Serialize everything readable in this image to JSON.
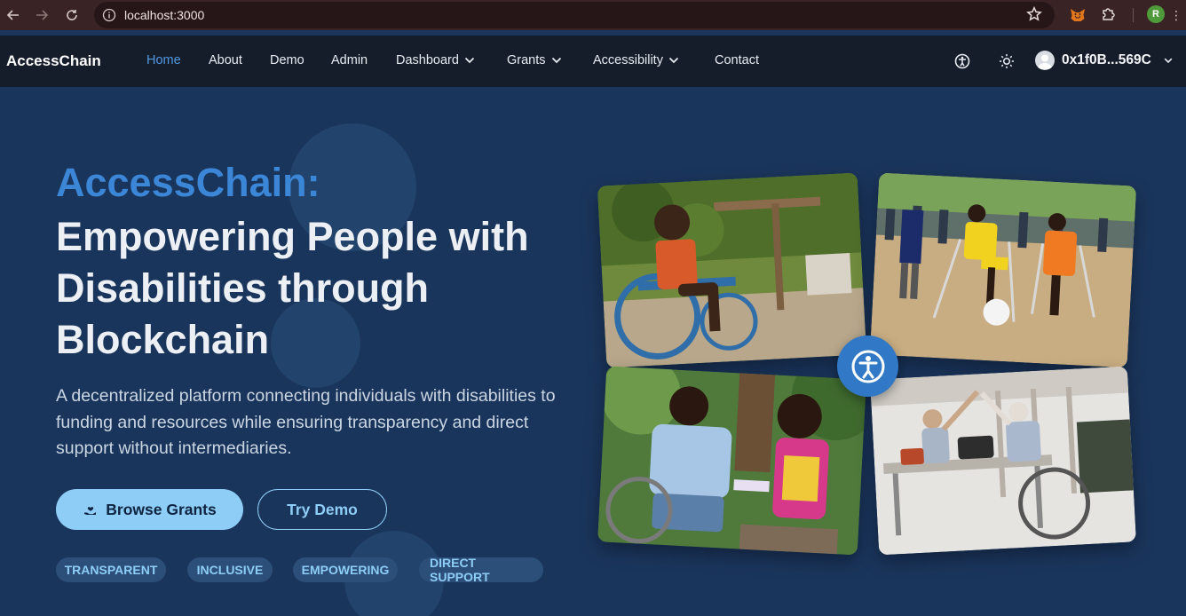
{
  "browser": {
    "url": "localhost:3000",
    "profile_initial": "R"
  },
  "site": {
    "brand": "AccessChain",
    "nav": [
      {
        "label": "Home",
        "active": true
      },
      {
        "label": "About"
      },
      {
        "label": "Demo"
      },
      {
        "label": "Admin"
      },
      {
        "label": "Dashboard",
        "dropdown": true
      },
      {
        "label": "Grants",
        "dropdown": true
      },
      {
        "label": "Accessibility",
        "dropdown": true
      },
      {
        "label": "Contact"
      }
    ],
    "wallet_address": "0x1f0B...569C"
  },
  "hero": {
    "title_accent": "AccessChain:",
    "title_main": "Empowering People with Disabilities through Blockchain",
    "description": "A decentralized platform connecting individuals with disabilities to funding and resources while ensuring transparency and direct support without intermediaries.",
    "primary_button": "Browse Grants",
    "secondary_button": "Try Demo",
    "tags": [
      "TRANSPARENT",
      "INCLUSIVE",
      "EMPOWERING",
      "DIRECT SUPPORT"
    ]
  },
  "colors": {
    "accent": "#3b86d6",
    "hero_background": "#1a355c",
    "button_primary": "#8ecdf6",
    "nav_background": "#161d2a"
  }
}
